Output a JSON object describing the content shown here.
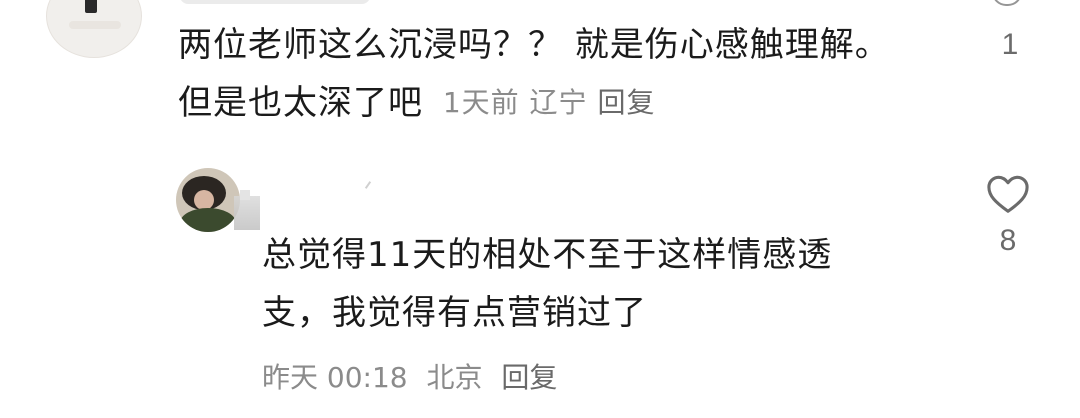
{
  "comments": [
    {
      "text_line1": "两位老师这么沉浸吗？？ 就是伤心感触理解。",
      "text_line2": "但是也太深了吧",
      "time": "1天前",
      "location": "辽宁",
      "reply_label": "回复",
      "likes": "1"
    },
    {
      "text_line1": "总觉得11天的相处不至于这样情感透",
      "text_line2": "支，我觉得有点营销过了",
      "time": "昨天 00:18",
      "location": "北京",
      "reply_label": "回复",
      "likes": "8"
    }
  ],
  "icons": {
    "like": "heart-outline-icon"
  },
  "colors": {
    "text": "#1b1b1b",
    "meta": "#8b8b8b",
    "icon": "#6b6b6b"
  }
}
